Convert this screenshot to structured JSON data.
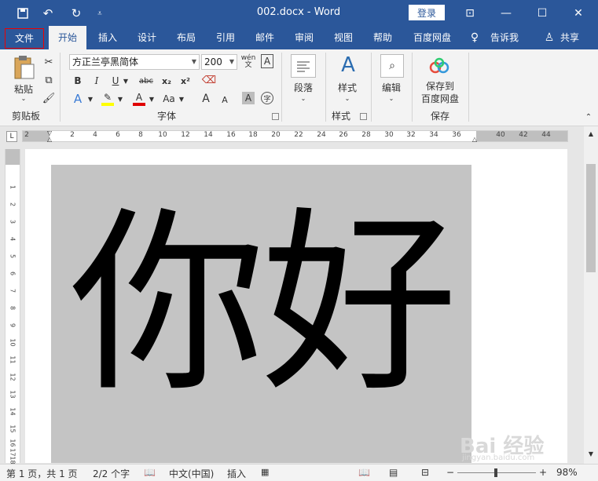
{
  "window": {
    "title": "002.docx  -  Word",
    "login_label": "登录",
    "minimize_glyph": "—",
    "maximize_glyph": "☐",
    "close_glyph": "✕",
    "ribbon_display_glyph": "⊡"
  },
  "quick_access": {
    "save_icon": "save-icon",
    "undo_icon": "undo-icon",
    "redo_icon": "redo-icon",
    "customize_icon": "customize-icon"
  },
  "tabs": [
    {
      "label": "文件"
    },
    {
      "label": "开始"
    },
    {
      "label": "插入"
    },
    {
      "label": "设计"
    },
    {
      "label": "布局"
    },
    {
      "label": "引用"
    },
    {
      "label": "邮件"
    },
    {
      "label": "审阅"
    },
    {
      "label": "视图"
    },
    {
      "label": "帮助"
    },
    {
      "label": "百度网盘"
    }
  ],
  "tell_me": "告诉我",
  "share": "共享",
  "ribbon": {
    "clipboard": {
      "paste_label": "粘贴",
      "group_label": "剪贴板"
    },
    "font": {
      "font_name": "方正兰亭黑简体",
      "font_size": "200",
      "group_label": "字体",
      "bold": "B",
      "italic": "I",
      "underline": "U",
      "strike": "abc",
      "subscript": "x₂",
      "superscript": "x²",
      "font_color_letter": "A",
      "case": "Aa",
      "grow": "A",
      "shrink": "A",
      "shading": "A",
      "phonetic": "wén",
      "enclose": "字"
    },
    "paragraph": {
      "label": "段落"
    },
    "styles": {
      "label": "样式",
      "group_label": "样式"
    },
    "editing": {
      "label": "编辑"
    },
    "save": {
      "label_line1": "保存到",
      "label_line2": "百度网盘",
      "group_label": "保存"
    }
  },
  "ruler": {
    "h_numbers": [
      "2",
      "2",
      "4",
      "6",
      "8",
      "10",
      "12",
      "14",
      "16",
      "18",
      "20",
      "22",
      "24",
      "26",
      "28",
      "30",
      "32",
      "34",
      "36",
      "40",
      "42",
      "44"
    ],
    "v_numbers": [
      "1",
      "2",
      "3",
      "4",
      "5",
      "6",
      "7",
      "8",
      "9",
      "10",
      "11",
      "12",
      "13",
      "14",
      "15",
      "16",
      "17",
      "18"
    ]
  },
  "document": {
    "text": "你好"
  },
  "status": {
    "page": "第 1 页，共 1 页",
    "words": "2/2 个字",
    "language": "中文(中国)",
    "mode": "插入",
    "zoom_minus": "−",
    "zoom_plus": "+",
    "zoom": "98%",
    "zoom_level": 0.49
  },
  "watermark": {
    "text": "Bai 经验",
    "sub": "jingyan.baidu.com"
  },
  "colors": {
    "brand": "#2b579a",
    "highlight": "#ffff00",
    "font_color": "#e00000",
    "shade": "#c4c4c4"
  }
}
